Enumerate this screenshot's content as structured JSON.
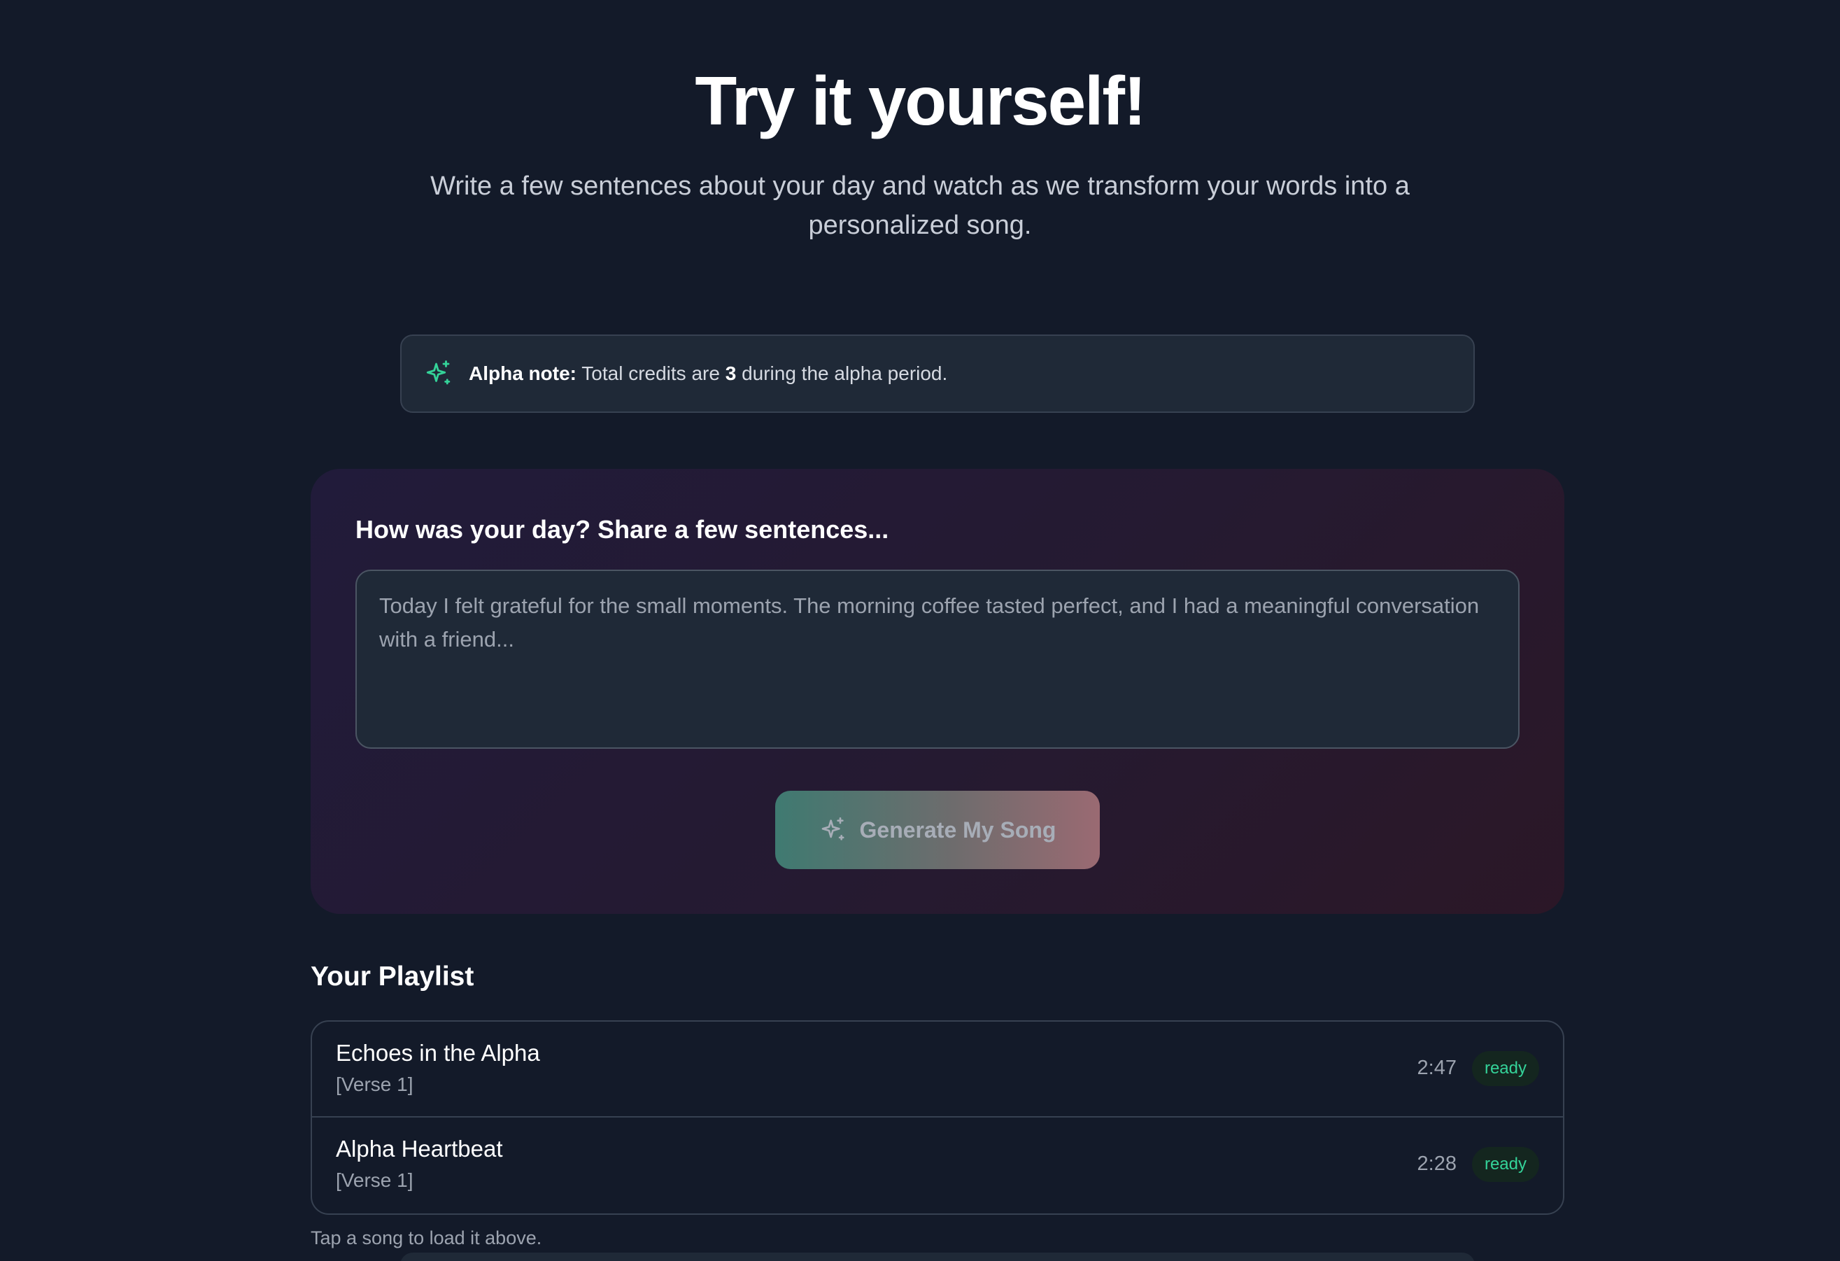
{
  "hero": {
    "title": "Try it yourself!",
    "subtitle": "Write a few sentences about your day and watch as we transform your words into a personalized song."
  },
  "alpha_note": {
    "icon": "sparkles-icon",
    "label": "Alpha note:",
    "text_before": "Total credits are",
    "credits": "3",
    "text_after": "during the alpha period."
  },
  "composer": {
    "label": "How was your day? Share a few sentences...",
    "input_value": "",
    "input_placeholder": "Today I felt grateful for the small moments. The morning coffee tasted perfect, and I had a meaningful conversation with a friend...",
    "generate_label": "Generate My Song",
    "generate_icon": "sparkles-icon"
  },
  "playlist": {
    "title": "Your Playlist",
    "songs": [
      {
        "title": "Echoes in the Alpha",
        "subtitle": "[Verse 1]",
        "duration": "2:47",
        "status": "ready"
      },
      {
        "title": "Alpha Heartbeat",
        "subtitle": "[Verse 1]",
        "duration": "2:28",
        "status": "ready"
      }
    ],
    "hint": "Tap a song to load it above."
  },
  "colors": {
    "background": "#131a29",
    "accent_green": "#34d399",
    "card": "#1f2937"
  }
}
